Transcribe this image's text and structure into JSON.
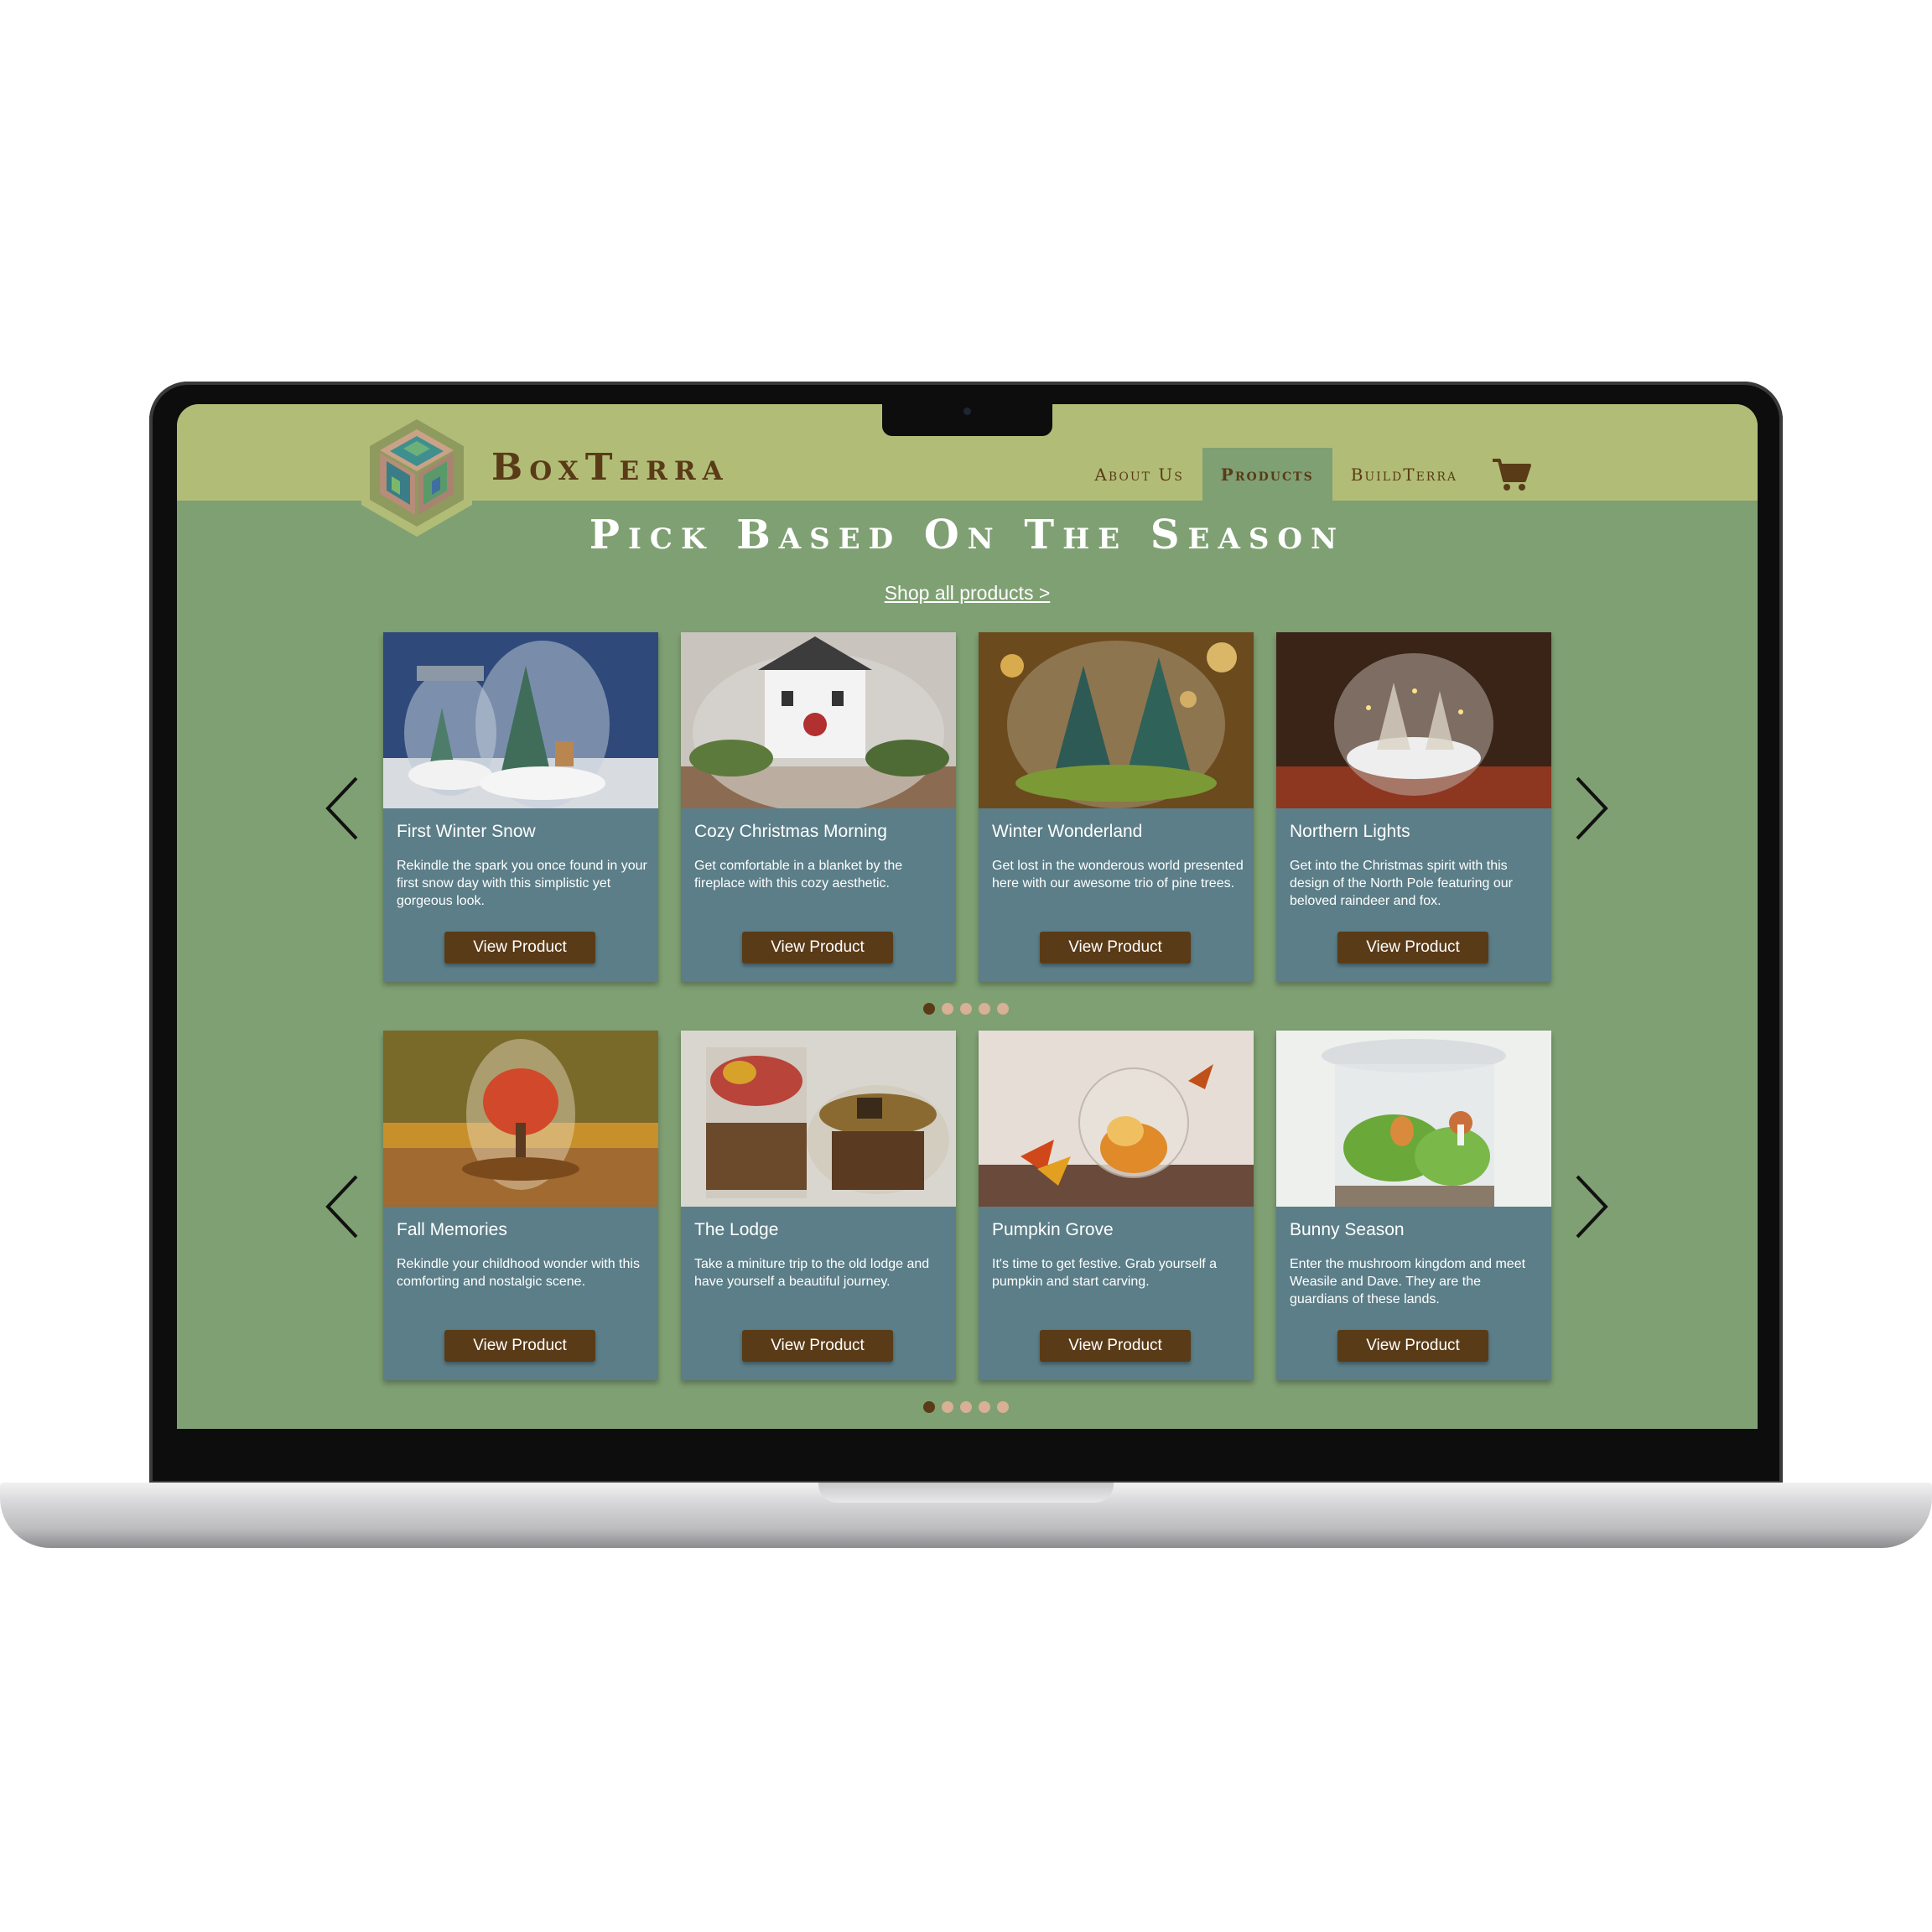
{
  "brand": {
    "name": "BoxTerra"
  },
  "nav": {
    "items": [
      {
        "label": "About Us"
      },
      {
        "label": "Products"
      },
      {
        "label": "BuildTerra"
      }
    ]
  },
  "page": {
    "title": "Pick Based On The Season",
    "shop_all": "Shop all products >"
  },
  "carousels": [
    {
      "cards": [
        {
          "title": "First Winter Snow",
          "desc": "Rekindle the spark you once found in your first snow day with this simplistic yet gorgeous look.",
          "button": "View Product"
        },
        {
          "title": "Cozy Christmas Morning",
          "desc": "Get comfortable in a blanket by the fireplace with this cozy aesthetic.",
          "button": "View Product"
        },
        {
          "title": "Winter Wonderland",
          "desc": "Get lost in the wonderous world presented here with our awesome trio of pine trees.",
          "button": "View Product"
        },
        {
          "title": "Northern Lights",
          "desc": "Get into the Christmas spirit with this design of the North Pole featuring our beloved raindeer and fox.",
          "button": "View Product"
        }
      ]
    },
    {
      "cards": [
        {
          "title": "Fall Memories",
          "desc": "Rekindle your childhood wonder with this comforting and nostalgic scene.",
          "button": "View Product"
        },
        {
          "title": "The Lodge",
          "desc": "Take a miniture trip to the old lodge and have yourself a beautiful journey.",
          "button": "View Product"
        },
        {
          "title": "Pumpkin Grove",
          "desc": "It's time to get festive. Grab yourself a pumpkin and start carving.",
          "button": "View Product"
        },
        {
          "title": "Bunny Season",
          "desc": "Enter the mushroom kingdom and meet Weasile and Dave. They are the guardians of these lands.",
          "button": "View Product"
        }
      ]
    }
  ],
  "colors": {
    "header_bg": "#b1bd77",
    "page_bg": "#7fa073",
    "card_bg": "#5b7e88",
    "brand_brown": "#5a3b17",
    "dot_inactive": "#d7b095"
  }
}
